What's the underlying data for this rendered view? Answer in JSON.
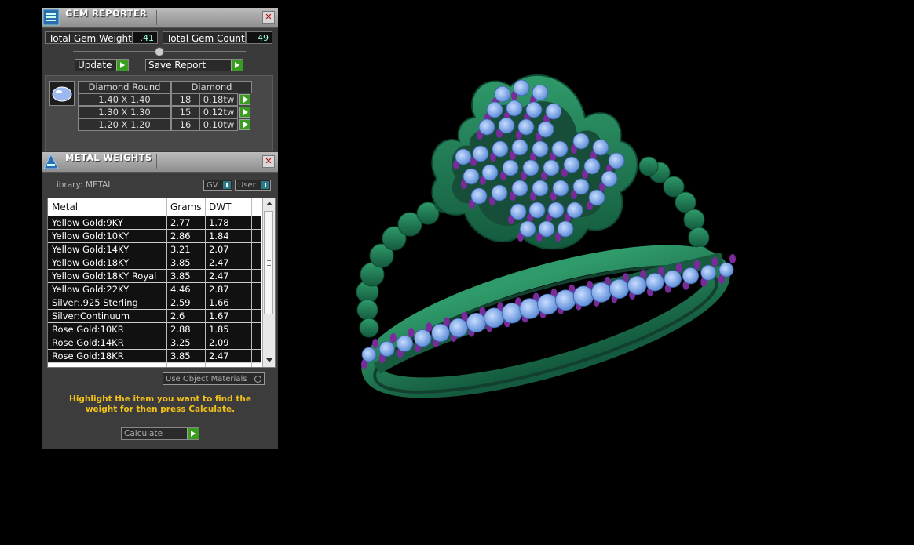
{
  "gem_reporter": {
    "title": "GEM REPORTER",
    "close_icon": "close-icon",
    "total_gem_weight_label": "Total Gem Weight",
    "total_gem_weight_value": ".41",
    "total_gem_count_label": "Total Gem Count",
    "total_gem_count_value": "49",
    "update_label": "Update",
    "save_report_label": "Save Report",
    "gem_table": {
      "shape_header": "Diamond Round",
      "material_header": "Diamond",
      "rows": [
        {
          "size": "1.40 X 1.40",
          "count": "18",
          "weight": "0.18tw"
        },
        {
          "size": "1.30 X 1.30",
          "count": "15",
          "weight": "0.12tw"
        },
        {
          "size": "1.20 X 1.20",
          "count": "16",
          "weight": "0.10tw"
        }
      ]
    }
  },
  "metal_weights": {
    "title": "METAL WEIGHTS",
    "library_label": "Library: METAL",
    "gv_label": "GV",
    "user_label": "User",
    "columns": [
      "Metal",
      "Grams",
      "DWT"
    ],
    "rows": [
      {
        "metal": "Yellow Gold:9KY",
        "grams": "2.77",
        "dwt": "1.78"
      },
      {
        "metal": "Yellow Gold:10KY",
        "grams": "2.86",
        "dwt": "1.84"
      },
      {
        "metal": "Yellow Gold:14KY",
        "grams": "3.21",
        "dwt": "2.07"
      },
      {
        "metal": "Yellow Gold:18KY",
        "grams": "3.85",
        "dwt": "2.47"
      },
      {
        "metal": "Yellow Gold:18KY Royal",
        "grams": "3.85",
        "dwt": "2.47"
      },
      {
        "metal": "Yellow Gold:22KY",
        "grams": "4.46",
        "dwt": "2.87"
      },
      {
        "metal": "Silver:.925 Sterling",
        "grams": "2.59",
        "dwt": "1.66"
      },
      {
        "metal": "Silver:Continuum",
        "grams": "2.6",
        "dwt": "1.67"
      },
      {
        "metal": "Rose Gold:10KR",
        "grams": "2.88",
        "dwt": "1.85"
      },
      {
        "metal": "Rose Gold:14KR",
        "grams": "3.25",
        "dwt": "2.09"
      },
      {
        "metal": "Rose Gold:18KR",
        "grams": "3.85",
        "dwt": "2.47"
      }
    ],
    "use_object_materials_label": "Use Object Materials",
    "hint_text": "Highlight the item you want to find the weight for then press Calculate.",
    "calculate_label": "Calculate"
  },
  "colors": {
    "ring_metal": "#1f7a55",
    "diamond": "#7fb0ef",
    "prong": "#7a2a9a",
    "hint": "#f2c21a",
    "accent_button": "#3b9c22"
  }
}
